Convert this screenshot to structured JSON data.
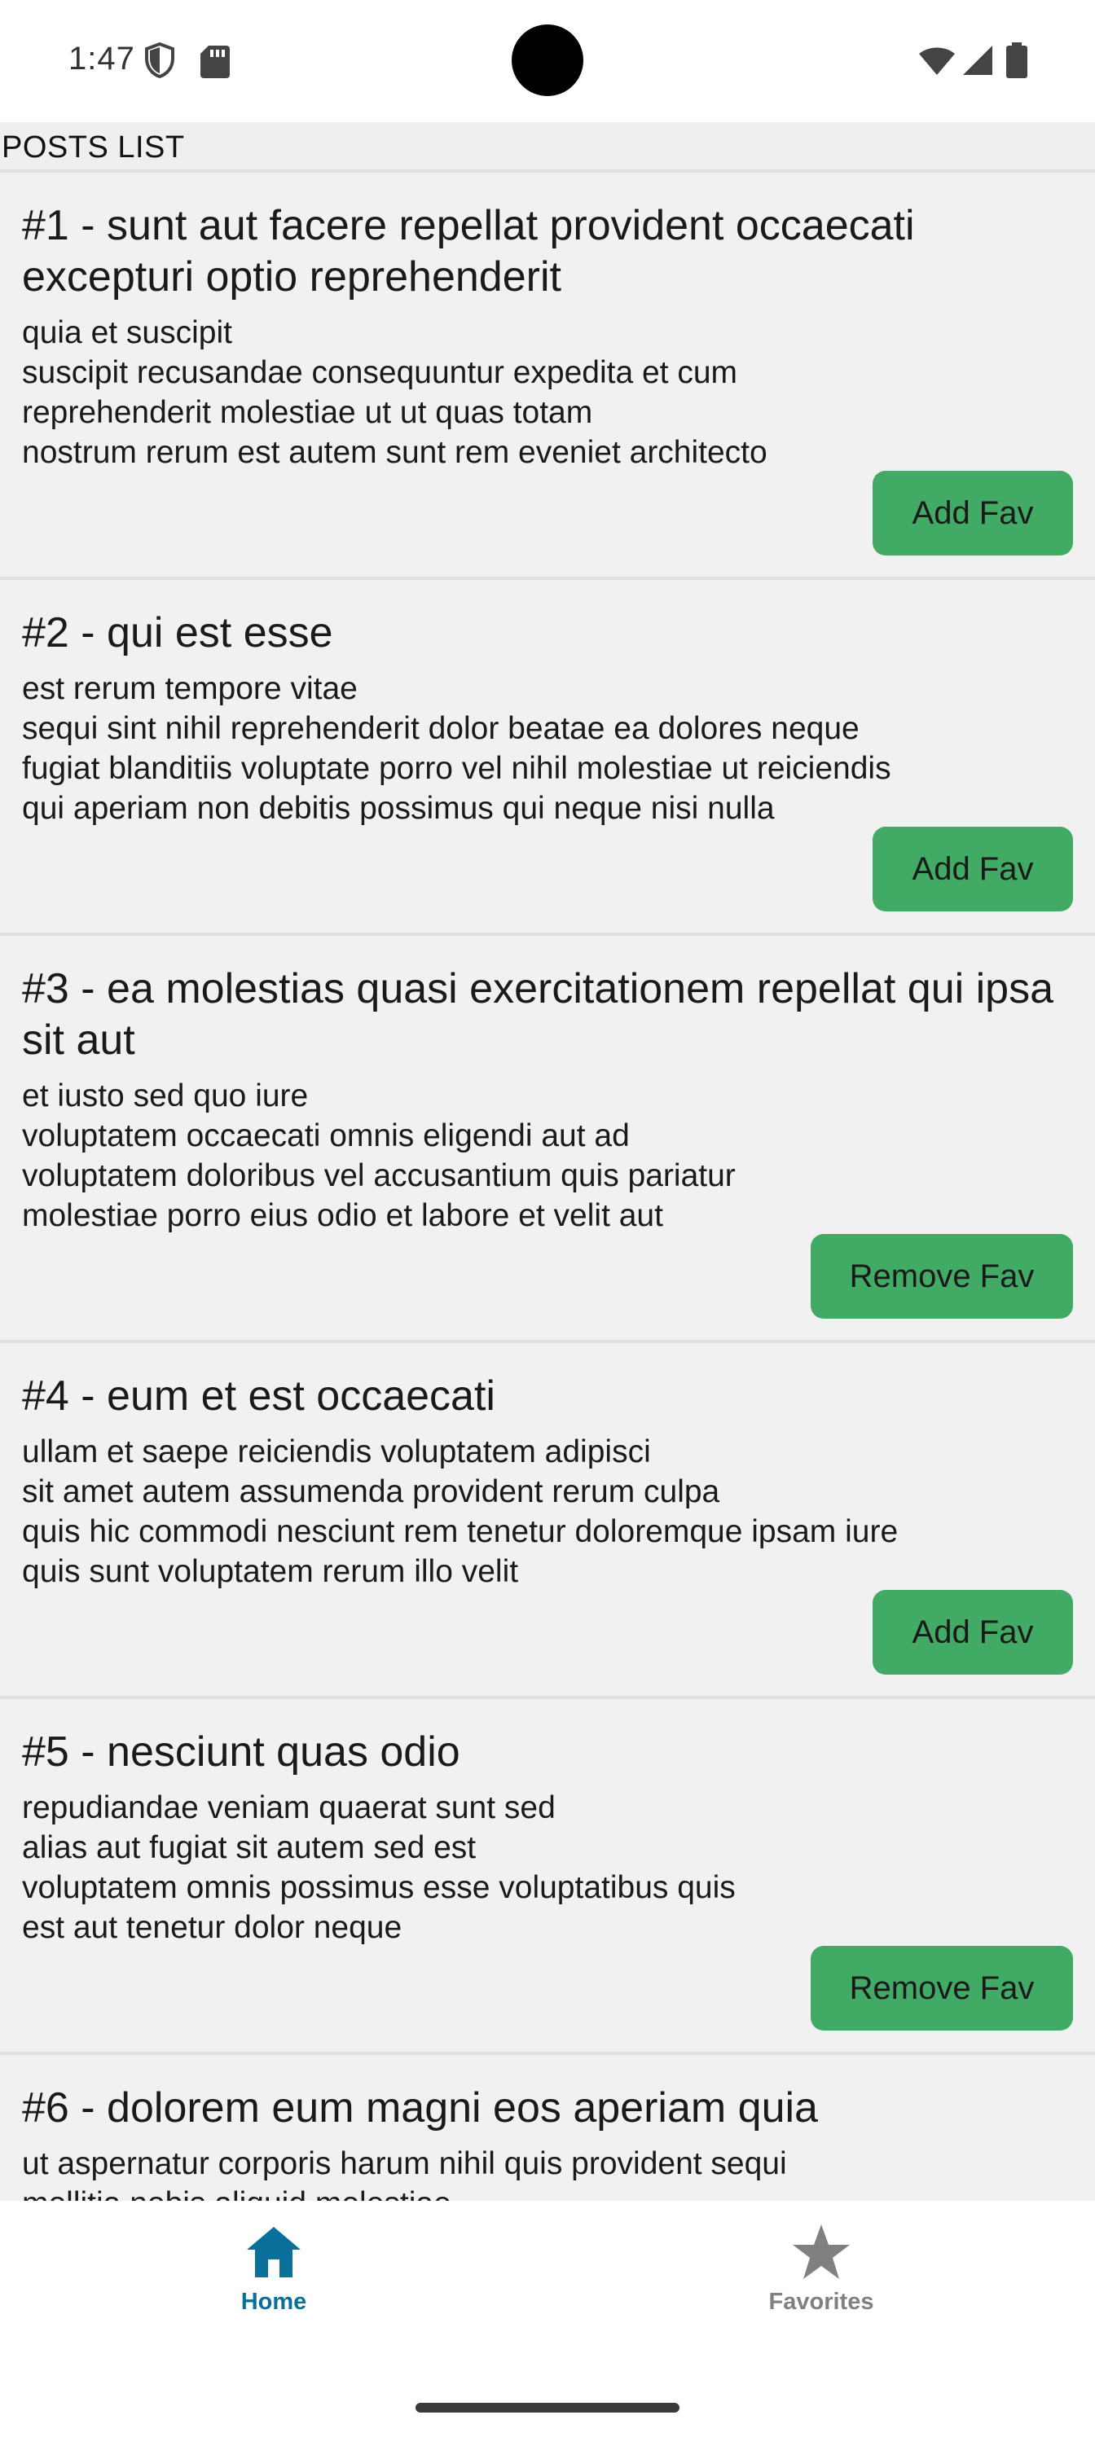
{
  "status_bar": {
    "time": "1:47",
    "icons": [
      "shield-icon",
      "sd-card-icon",
      "wifi-icon",
      "cell-signal-icon",
      "battery-icon"
    ]
  },
  "page": {
    "title": "POSTS LIST"
  },
  "posts": [
    {
      "title": "#1 - sunt aut facere repellat provident occaecati excepturi optio reprehenderit",
      "body": "quia et suscipit\nsuscipit recusandae consequuntur expedita et cum\nreprehenderit molestiae ut ut quas totam\nnostrum rerum est autem sunt rem eveniet architecto",
      "button": "Add Fav"
    },
    {
      "title": "#2 - qui est esse",
      "body": "est rerum tempore vitae\nsequi sint nihil reprehenderit dolor beatae ea dolores neque\nfugiat blanditiis voluptate porro vel nihil molestiae ut reiciendis\nqui aperiam non debitis possimus qui neque nisi nulla",
      "button": "Add Fav"
    },
    {
      "title": "#3 - ea molestias quasi exercitationem repellat qui ipsa sit aut",
      "body": "et iusto sed quo iure\nvoluptatem occaecati omnis eligendi aut ad\nvoluptatem doloribus vel accusantium quis pariatur\nmolestiae porro eius odio et labore et velit aut",
      "button": "Remove Fav"
    },
    {
      "title": "#4 - eum et est occaecati",
      "body": "ullam et saepe reiciendis voluptatem adipisci\nsit amet autem assumenda provident rerum culpa\nquis hic commodi nesciunt rem tenetur doloremque ipsam iure\nquis sunt voluptatem rerum illo velit",
      "button": "Add Fav"
    },
    {
      "title": "#5 - nesciunt quas odio",
      "body": "repudiandae veniam quaerat sunt sed\nalias aut fugiat sit autem sed est\nvoluptatem omnis possimus esse voluptatibus quis\nest aut tenetur dolor neque",
      "button": "Remove Fav"
    },
    {
      "title": "#6 - dolorem eum magni eos aperiam quia",
      "body": "ut aspernatur corporis harum nihil quis provident sequi\nmollitia nobis aliquid molestiae"
    }
  ],
  "bottom_nav": {
    "items": [
      {
        "label": "Home",
        "icon": "home-icon",
        "active": true
      },
      {
        "label": "Favorites",
        "icon": "star-icon",
        "active": false
      }
    ]
  },
  "colors": {
    "button_green": "#41ab65",
    "nav_active": "#0a7099",
    "nav_inactive": "#808080",
    "content_bg": "#efefef"
  }
}
